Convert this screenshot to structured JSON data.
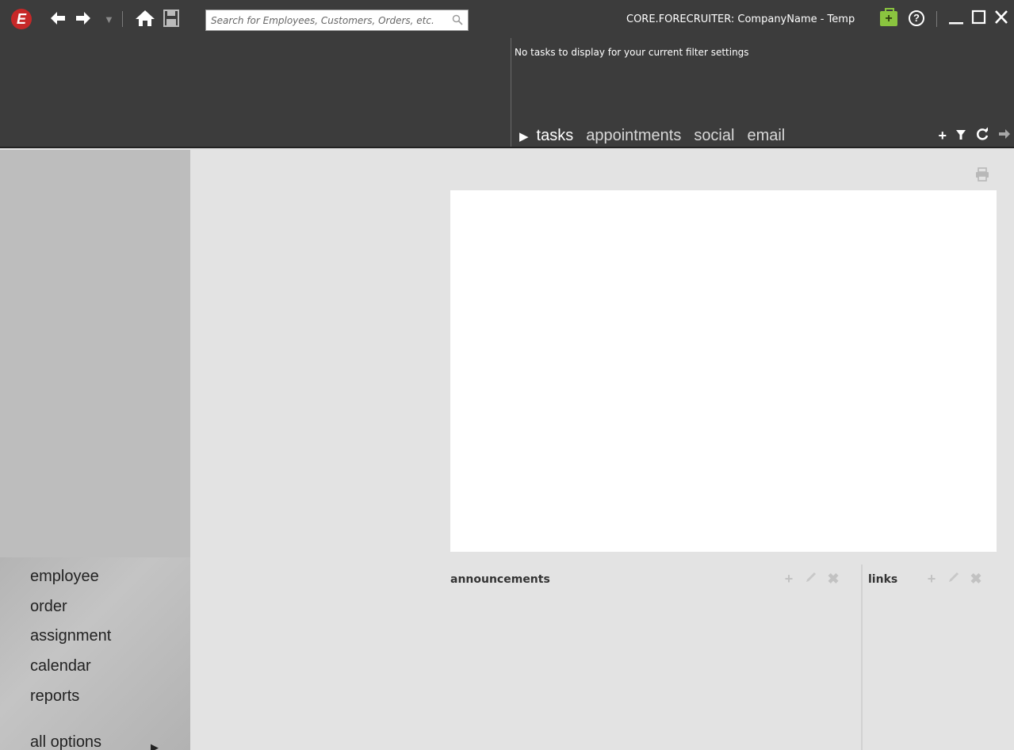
{
  "app": {
    "logo_letter": "E",
    "window_title": "CORE.FORECRUITER: CompanyName - Temp"
  },
  "toolbar": {
    "back_icon": "back-arrow-icon",
    "forward_icon": "forward-arrow-icon",
    "history_icon": "history-dropdown-icon",
    "home_icon": "home-icon",
    "save_icon": "save-icon",
    "search_placeholder": "Search for Employees, Customers, Orders, etc.",
    "search_value": ""
  },
  "header": {
    "tasks_message": "No tasks to display for your current filter settings",
    "tabs": [
      {
        "label": "tasks",
        "active": true
      },
      {
        "label": "appointments",
        "active": false
      },
      {
        "label": "social",
        "active": false
      },
      {
        "label": "email",
        "active": false
      }
    ],
    "tools": [
      "add-icon",
      "filter-icon",
      "refresh-icon",
      "forward-icon"
    ]
  },
  "sidebar": {
    "items": [
      {
        "label": "employee"
      },
      {
        "label": "order"
      },
      {
        "label": "assignment"
      },
      {
        "label": "calendar"
      },
      {
        "label": "reports"
      }
    ],
    "all_options_label": "all options"
  },
  "main": {
    "announcements_title": "announcements",
    "links_title": "links"
  },
  "colors": {
    "titlebar_bg": "#3c3c3c",
    "sidebar_bg": "#bdbdbd",
    "main_bg": "#e3e3e3",
    "logo_red": "#c62828",
    "bag_green": "#8ac43f"
  }
}
